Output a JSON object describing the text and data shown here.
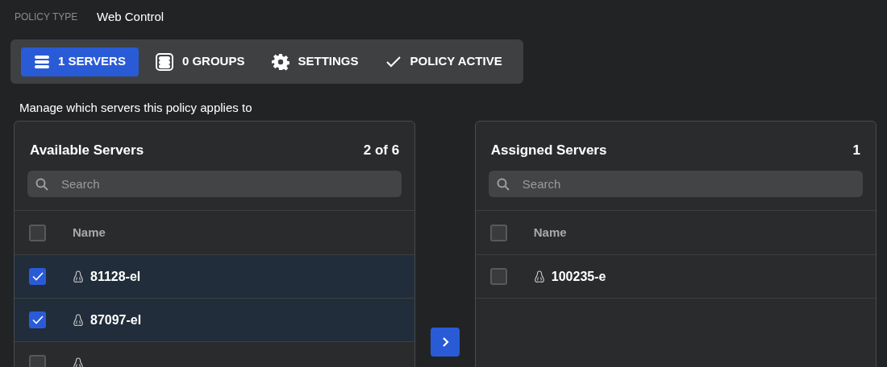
{
  "policy_type": {
    "label": "POLICY TYPE",
    "value": "Web Control"
  },
  "tabs": [
    {
      "label": "1 SERVERS",
      "selected": true
    },
    {
      "label": "0 GROUPS",
      "selected": false
    },
    {
      "label": "SETTINGS",
      "selected": false
    },
    {
      "label": "POLICY ACTIVE",
      "selected": false
    }
  ],
  "description": "Manage which servers this policy applies to",
  "available": {
    "title": "Available Servers",
    "count": "2 of 6",
    "search": {
      "placeholder": "Search"
    },
    "column": "Name",
    "all_checked": false,
    "rows": [
      {
        "name": "81128-el",
        "checked": true,
        "selected": true
      },
      {
        "name": "87097-el",
        "checked": true,
        "selected": true
      },
      {
        "checked": false,
        "selected": false
      }
    ]
  },
  "assigned": {
    "title": "Assigned Servers",
    "count": "1",
    "search": {
      "placeholder": "Search"
    },
    "column": "Name",
    "all_checked": false,
    "rows": [
      {
        "name": "100235-e",
        "checked": false,
        "selected": false
      }
    ]
  }
}
